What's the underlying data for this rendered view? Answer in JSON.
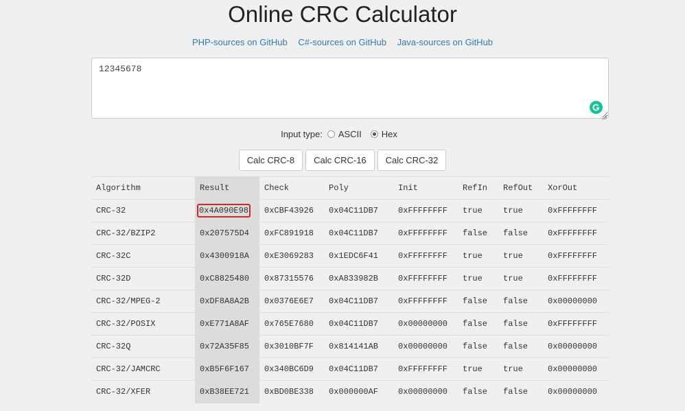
{
  "page": {
    "title": "Online CRC Calculator",
    "links": [
      "PHP-sources on GitHub",
      "C#-sources on GitHub",
      "Java-sources on GitHub"
    ]
  },
  "input": {
    "value": "12345678"
  },
  "input_type": {
    "label": "Input type:",
    "options": [
      {
        "label": "ASCII",
        "checked": false
      },
      {
        "label": "Hex",
        "checked": true
      }
    ]
  },
  "buttons": [
    "Calc CRC-8",
    "Calc CRC-16",
    "Calc CRC-32"
  ],
  "table": {
    "headers": [
      "Algorithm",
      "Result",
      "Check",
      "Poly",
      "Init",
      "RefIn",
      "RefOut",
      "XorOut"
    ],
    "rows": [
      [
        "CRC-32",
        "0x4A090E98",
        "0xCBF43926",
        "0x04C11DB7",
        "0xFFFFFFFF",
        "true",
        "true",
        "0xFFFFFFFF"
      ],
      [
        "CRC-32/BZIP2",
        "0x207575D4",
        "0xFC891918",
        "0x04C11DB7",
        "0xFFFFFFFF",
        "false",
        "false",
        "0xFFFFFFFF"
      ],
      [
        "CRC-32C",
        "0x4300918A",
        "0xE3069283",
        "0x1EDC6F41",
        "0xFFFFFFFF",
        "true",
        "true",
        "0xFFFFFFFF"
      ],
      [
        "CRC-32D",
        "0xC8825480",
        "0x87315576",
        "0xA833982B",
        "0xFFFFFFFF",
        "true",
        "true",
        "0xFFFFFFFF"
      ],
      [
        "CRC-32/MPEG-2",
        "0xDF8A8A2B",
        "0x0376E6E7",
        "0x04C11DB7",
        "0xFFFFFFFF",
        "false",
        "false",
        "0x00000000"
      ],
      [
        "CRC-32/POSIX",
        "0xE771A8AF",
        "0x765E7680",
        "0x04C11DB7",
        "0x00000000",
        "false",
        "false",
        "0xFFFFFFFF"
      ],
      [
        "CRC-32Q",
        "0x72A35F85",
        "0x3010BF7F",
        "0x814141AB",
        "0x00000000",
        "false",
        "false",
        "0x00000000"
      ],
      [
        "CRC-32/JAMCRC",
        "0xB5F6F167",
        "0x340BC6D9",
        "0x04C11DB7",
        "0xFFFFFFFF",
        "true",
        "true",
        "0x00000000"
      ],
      [
        "CRC-32/XFER",
        "0xB38EE721",
        "0xBD0BE338",
        "0x000000AF",
        "0x00000000",
        "false",
        "false",
        "0x00000000"
      ]
    ],
    "highlighted_cell": {
      "row": 0,
      "col": 1,
      "color": "#d9261c"
    }
  },
  "colors": {
    "link": "#337ab7",
    "grammarly": "#15c39a",
    "result_column": "#dcdcdc"
  },
  "icons": {
    "grammarly": "grammarly-icon",
    "resize": "resize-handle-icon"
  }
}
